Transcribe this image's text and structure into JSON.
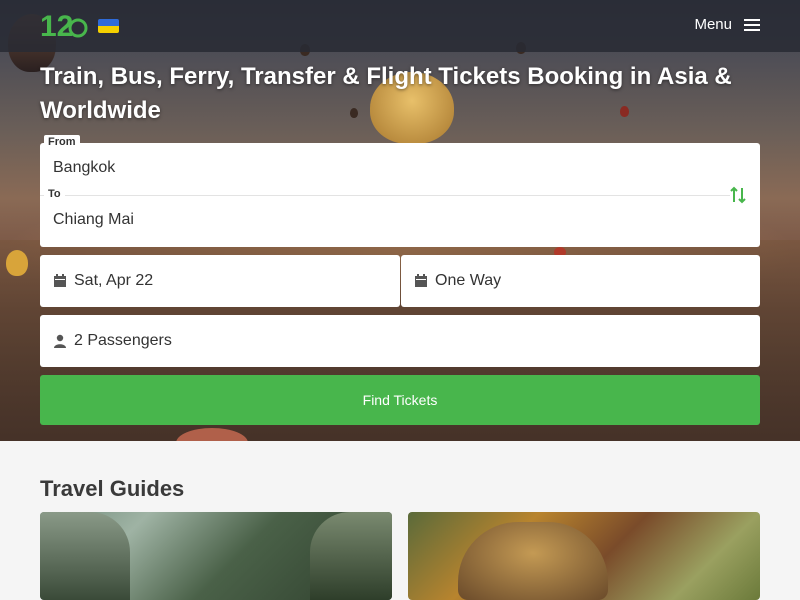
{
  "header": {
    "logo_alt": "12Go",
    "menu_label": "Menu",
    "colors": {
      "topbar": "#282a34",
      "logo": "#48b64c",
      "flag_blue": "#2f6bd8",
      "flag_yellow": "#f4d000"
    }
  },
  "hero": {
    "headline": "Train, Bus, Ferry, Transfer & Flight Tickets Booking in Asia & Worldwide"
  },
  "search": {
    "from_label": "From",
    "from_value": "Bangkok",
    "to_label": "To",
    "to_value": "Chiang Mai",
    "date_value": "Sat, Apr 22",
    "trip_type_value": "One Way",
    "passengers_value": "2 Passengers",
    "submit_label": "Find Tickets",
    "accent_color": "#48b64c"
  },
  "guides": {
    "title": "Travel Guides"
  }
}
